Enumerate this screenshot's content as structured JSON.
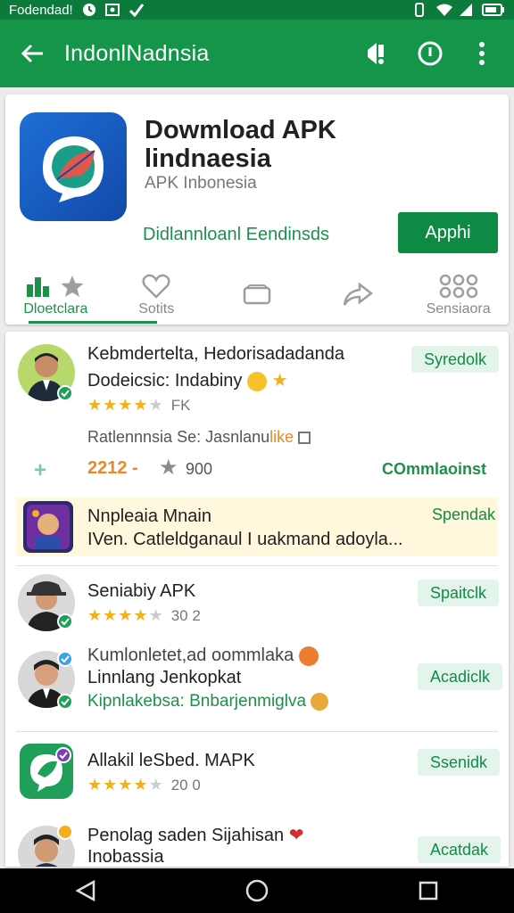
{
  "status_bar": {
    "app_name": "Fodendad!",
    "icons": [
      "circle-icon",
      "photo-icon",
      "check-icon",
      "vibrate-icon",
      "wifi-icon",
      "signal-icon",
      "battery-icon"
    ]
  },
  "app_bar": {
    "title": "IndonlNadnsia",
    "actions": [
      "alert-icon",
      "info-icon",
      "more-vert-icon"
    ]
  },
  "header": {
    "title": "Dowmload APK lindnaesia",
    "subtitle": "APK Inbonesia",
    "description": "Didlannloanl Eendinsds",
    "button_label": "Apphi",
    "tabs": [
      {
        "label": "Dloetclara",
        "icon": "chart-star-icon",
        "active": true
      },
      {
        "label": "Sotits",
        "icon": "heart-icon",
        "active": false
      },
      {
        "label": "",
        "icon": "folder-icon",
        "active": false
      },
      {
        "label": "",
        "icon": "share-icon",
        "active": false
      },
      {
        "label": "Sensiaora",
        "icon": "grid-icon",
        "active": false
      }
    ]
  },
  "list": {
    "items": [
      {
        "line1": "Kebmdertelta, Hedorisadadanda",
        "line2": "Dodeicsic: Indabiny",
        "rating_text": "FK",
        "stars": 4,
        "button": "Syredolk"
      },
      {
        "line1": "Ratlennnsia Se: Jasnlanu",
        "like": "like",
        "count1": "2212 -",
        "count2": "900",
        "link": "COmmlaoinst"
      },
      {
        "line1": "Nnpleaia Mnain",
        "line2": "IVen. Catleldganaul I uakmand adoyla...",
        "button": "Spendak"
      },
      {
        "line1": "Seniabiy APK",
        "rating_text": "30   2",
        "stars": 4,
        "button": "Spaitclk"
      },
      {
        "line1": "Kumlonletet,ad oommlaka",
        "line2": "Linnlang Jenkopkat",
        "line3": "Kipnlakebsa: Bnbarjenmiglva",
        "button": "Acadiclk"
      },
      {
        "line1": "Allakil leSbed. MAPK",
        "rating_text": "20   0",
        "stars": 4,
        "button": "Ssenidk"
      },
      {
        "line1": "Penolag saden Sijahisan",
        "line2": "Inobassia",
        "button": "Acatdak"
      }
    ]
  },
  "colors": {
    "status_bar": "#0b7a3b",
    "app_bar": "#14954a",
    "accent": "#0f8a45",
    "star": "#f2b01e",
    "highlight_row": "#fff8dc"
  }
}
